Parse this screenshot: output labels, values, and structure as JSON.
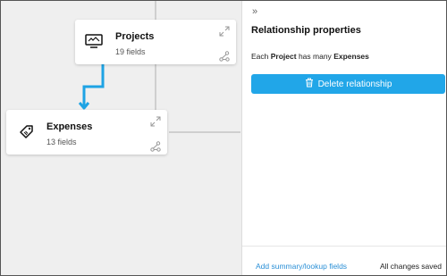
{
  "panel": {
    "collapse_icon": "double-chevron-right-icon",
    "title": "Relationship properties",
    "description": {
      "prefix": "Each",
      "parent": "Project",
      "middle": "has many",
      "child": "Expenses"
    },
    "delete_button": {
      "label": "Delete relationship",
      "icon": "trash-icon"
    },
    "footer": {
      "link": "Add summary/lookup fields",
      "status": "All changes saved"
    }
  },
  "canvas": {
    "cards": [
      {
        "title": "Projects",
        "subtitle": "19 fields",
        "icon": "monitor-icon"
      },
      {
        "title": "Expenses",
        "subtitle": "13 fields",
        "icon": "price-tag-icon"
      }
    ],
    "colors": {
      "link_line": "#1ea3e4",
      "connector": "#cfcfcf",
      "button": "#21a6e8"
    }
  }
}
